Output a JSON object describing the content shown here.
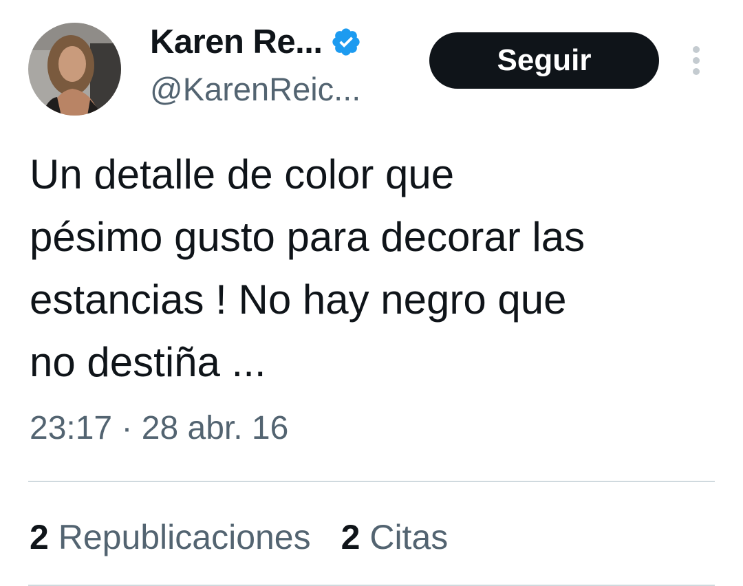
{
  "author": {
    "display_name": "Karen Re...",
    "handle": "@KarenReic...",
    "verified": true,
    "avatar_icon": "profile-photo",
    "verified_color": "#1d9bf0"
  },
  "follow_label": "Seguir",
  "more_icon": "vertical-ellipsis-icon",
  "tweet": {
    "text": "Un detalle de color que\npésimo gusto para decorar las\nestancias ! No hay negro que\nno destiña ...",
    "timestamp": "23:17 · 28 abr. 16"
  },
  "stats": [
    {
      "count": "2",
      "label": "Republicaciones"
    },
    {
      "count": "2",
      "label": "Citas"
    }
  ],
  "colors": {
    "text": "#0f1419",
    "secondary": "#536471",
    "divider": "#cfd9de",
    "button_bg": "#0f1419"
  }
}
